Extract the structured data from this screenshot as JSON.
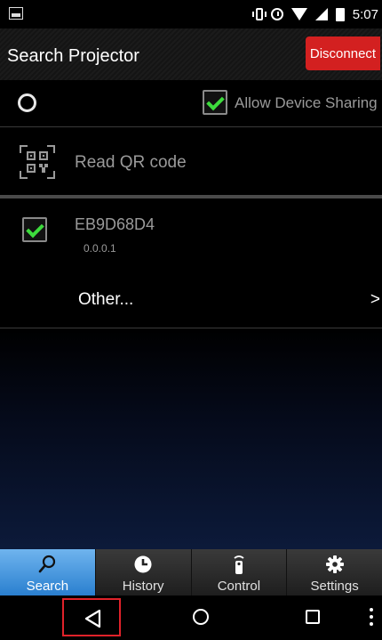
{
  "status_bar": {
    "time": "5:07"
  },
  "header": {
    "title": "Search Projector",
    "disconnect_label": "Disconnect"
  },
  "sharing": {
    "label": "Allow Device Sharing",
    "checked": true
  },
  "qr": {
    "label": "Read QR code"
  },
  "device": {
    "name": "EB9D68D4",
    "ip": "0.0.0.1",
    "checked": true
  },
  "other": {
    "label": "Other...",
    "arrow": ">"
  },
  "tabs": [
    {
      "label": "Search",
      "icon": "search-icon",
      "active": true
    },
    {
      "label": "History",
      "icon": "clock-icon",
      "active": false
    },
    {
      "label": "Control",
      "icon": "remote-icon",
      "active": false
    },
    {
      "label": "Settings",
      "icon": "gear-icon",
      "active": false
    }
  ],
  "colors": {
    "accent_red": "#d32020",
    "tab_active": "#2a7fcf",
    "check_green": "#3ddc3d"
  }
}
